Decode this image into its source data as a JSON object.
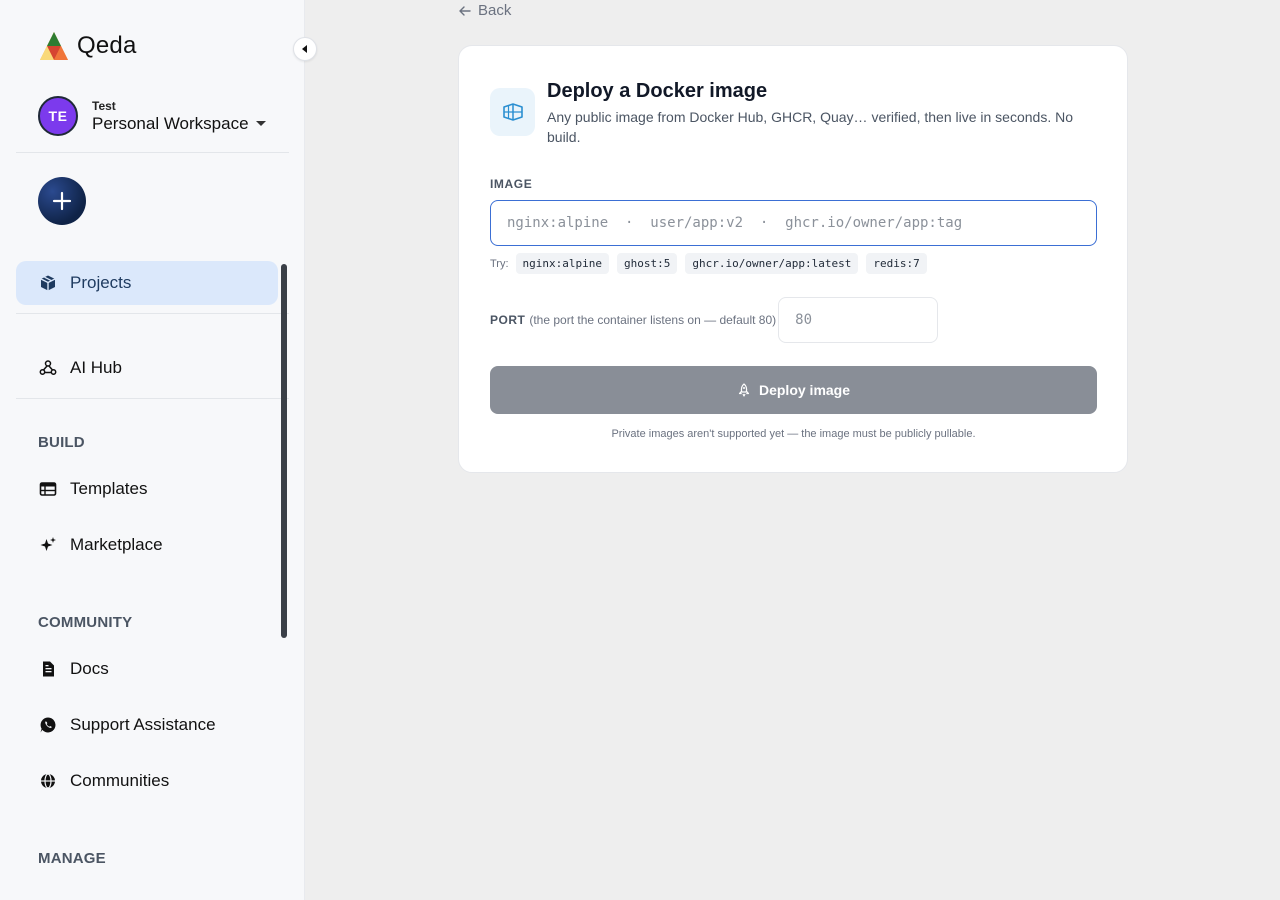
{
  "brand": {
    "name": "Qeda"
  },
  "workspace": {
    "initials": "TE",
    "owner": "Test",
    "name": "Personal Workspace"
  },
  "nav": {
    "projects": "Projects",
    "ai_hub": "AI Hub",
    "build_label": "BUILD",
    "templates": "Templates",
    "marketplace": "Marketplace",
    "community_label": "COMMUNITY",
    "docs": "Docs",
    "support": "Support Assistance",
    "communities": "Communities",
    "manage_label": "MANAGE"
  },
  "back": {
    "label": "Back"
  },
  "card": {
    "title": "Deploy a Docker image",
    "subtitle": "Any public image from Docker Hub, GHCR, Quay… verified, then live in seconds. No build.",
    "image_label": "IMAGE",
    "image_placeholder": "nginx:alpine  ·  user/app:v2  ·  ghcr.io/owner/app:tag",
    "try_label": "Try:",
    "suggestions": [
      "nginx:alpine",
      "ghost:5",
      "ghcr.io/owner/app:latest",
      "redis:7"
    ],
    "port_label": "PORT",
    "port_hint": "(the port the container listens on — default 80)",
    "port_placeholder": "80",
    "deploy_label": "Deploy image",
    "footnote": "Private images aren't supported yet — the image must be publicly pullable."
  },
  "colors": {
    "accent": "#3b6fd4",
    "active_nav_bg": "#dbe8fb",
    "avatar": "#7c3aed",
    "button_disabled": "#898e97"
  }
}
